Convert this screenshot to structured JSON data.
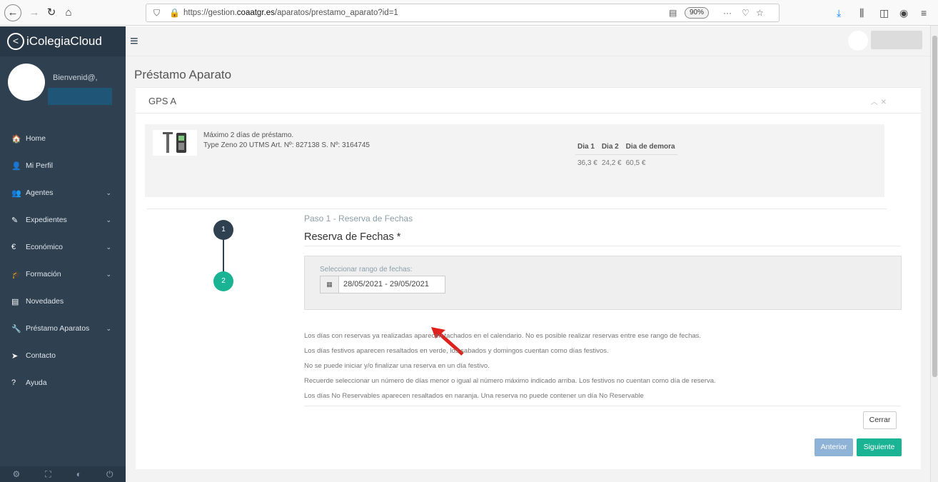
{
  "browser": {
    "url_prefix": "https://gestion.",
    "url_domain": "coaatgr.es",
    "url_path": "/aparatos/prestamo_aparato?id=1",
    "zoom": "90%"
  },
  "sidebar": {
    "brand": "iColegiaCloud",
    "welcome": "Bienvenid@,",
    "items": [
      {
        "label": "Home",
        "icon": "home-icon",
        "glyph": "🏠",
        "has_submenu": false
      },
      {
        "label": "Mi Perfil",
        "icon": "user-icon",
        "glyph": "👤",
        "has_submenu": false
      },
      {
        "label": "Agentes",
        "icon": "users-icon",
        "glyph": "👥",
        "has_submenu": true
      },
      {
        "label": "Expedientes",
        "icon": "edit-icon",
        "glyph": "✎",
        "has_submenu": true
      },
      {
        "label": "Económico",
        "icon": "euro-icon",
        "glyph": "€",
        "has_submenu": true
      },
      {
        "label": "Formación",
        "icon": "graduation-cap-icon",
        "glyph": "🎓",
        "has_submenu": true
      },
      {
        "label": "Novedades",
        "icon": "newspaper-icon",
        "glyph": "▤",
        "has_submenu": false
      },
      {
        "label": "Préstamo Aparatos",
        "icon": "wrench-icon",
        "glyph": "🔧",
        "has_submenu": true
      },
      {
        "label": "Contacto",
        "icon": "paper-plane-icon",
        "glyph": "➤",
        "has_submenu": false
      },
      {
        "label": "Ayuda",
        "icon": "question-icon",
        "glyph": "?",
        "has_submenu": false
      }
    ]
  },
  "main": {
    "page_title": "Préstamo Aparato",
    "panel_title": "GPS A",
    "device": {
      "line1": "Máximo 2 días de préstamo.",
      "line2": "Type Zeno 20 UTMS Art. Nº: 827138 S. Nº: 3164745"
    },
    "prices": {
      "headers": [
        "Dia 1",
        "Dia 2",
        "Dia de demora"
      ],
      "values": [
        "36,3 €",
        "24,2 €",
        "60,5 €"
      ]
    },
    "steps": [
      "1",
      "2"
    ],
    "step_label": "Paso 1 - Reserva de Fechas",
    "section_title": "Reserva de Fechas *",
    "date_label": "Seleccionar rango de fechas:",
    "date_value": "28/05/2021 - 29/05/2021",
    "info_lines": [
      "Los días con reservas ya realizadas aparecen tachados en el calendario. No es posible realizar reservas entre ese rango de fechas.",
      "Los días festivos aparecen resaltados en verde, los sabados y domingos cuentan como días festivos.",
      "No se puede iniciar y/o finalizar una reserva en un día festivo.",
      "Recuerde seleccionar un número de días menor o igual al número máximo indicado arriba. Los festivos no cuentan como día de reserva.",
      "Los días No Reservables aparecen resaltados en naranja. Una reserva no puede contener un día No Reservable"
    ],
    "buttons": {
      "cerrar": "Cerrar",
      "anterior": "Anterior",
      "siguiente": "Siguiente"
    }
  },
  "colors": {
    "sidebar": "#2f4050",
    "accent_green": "#1ab394",
    "accent_blue": "#8fb3d6",
    "annotation_arrow": "#e0201b"
  }
}
